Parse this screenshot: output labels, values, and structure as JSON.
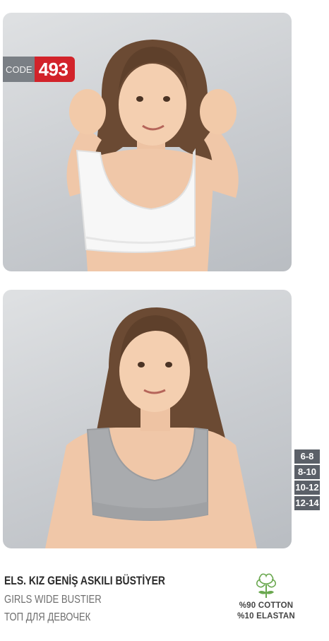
{
  "badge": {
    "code_label": "CODE",
    "code_number": "493"
  },
  "sizes": [
    "6-8",
    "8-10",
    "10-12",
    "12-14"
  ],
  "product": {
    "title_tr": "ELS. KIZ GENİŞ ASKILI BÜSTİYER",
    "title_en": "GIRLS WIDE  BUSTIER",
    "title_ru": "ТОП ДЛЯ ДЕВОЧЕК"
  },
  "fabric": {
    "icon": "cotton-plant-icon",
    "composition": [
      "%90 COTTON",
      "%10 ELASTAN"
    ]
  },
  "colors": {
    "badge_red": "#d2232a",
    "badge_gray": "#7a7f85",
    "size_chip": "#5b6068",
    "cotton_green": "#6aa84f",
    "top_white": "#f7f7f7",
    "top_gray": "#a9abae"
  }
}
